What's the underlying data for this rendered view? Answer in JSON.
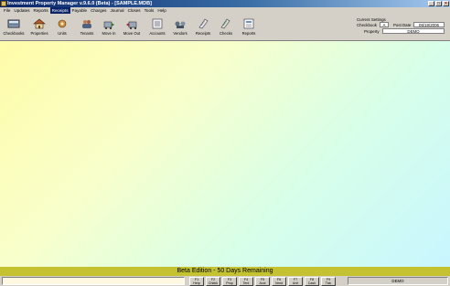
{
  "window": {
    "title": "Investment Property Manager v.9.6.0 (Beta) - [SAMPLE.MDB]"
  },
  "menu": [
    {
      "label": "File"
    },
    {
      "label": "Updates"
    },
    {
      "label": "Reports"
    },
    {
      "label": "Receipts"
    },
    {
      "label": "Payable"
    },
    {
      "label": "Charges"
    },
    {
      "label": "Journal"
    },
    {
      "label": "Closes"
    },
    {
      "label": "Tools"
    },
    {
      "label": "Help"
    }
  ],
  "toolbar": [
    {
      "label": "Checkbooks",
      "icon": "checkbook-icon"
    },
    {
      "label": "Properties",
      "icon": "house-icon"
    },
    {
      "label": "Units",
      "icon": "unit-icon"
    },
    {
      "label": "Tenants",
      "icon": "tenants-icon"
    },
    {
      "label": "Move In",
      "icon": "move-in-icon"
    },
    {
      "label": "Move Out",
      "icon": "move-out-icon"
    },
    {
      "label": "Accounts",
      "icon": "accounts-icon"
    },
    {
      "label": "Vendors",
      "icon": "vendors-icon"
    },
    {
      "label": "Receipts",
      "icon": "receipts-icon"
    },
    {
      "label": "Checks",
      "icon": "checks-icon"
    },
    {
      "label": "Reports",
      "icon": "reports-icon"
    }
  ],
  "settings": {
    "title": "Current Settings",
    "checkbook_label": "Checkbook",
    "checkbook_value": "A",
    "post_date_label": "Post Date",
    "post_date_value": "06/19/2006",
    "property_label": "Property",
    "property_value": "DEMO"
  },
  "beta_banner": "Beta Edition - 50 Days Remaining",
  "fkeys": [
    {
      "key": "F1",
      "label": "Help"
    },
    {
      "key": "F2",
      "label": "Chkbk"
    },
    {
      "key": "F3",
      "label": "Prop"
    },
    {
      "key": "F4",
      "label": "Tent"
    },
    {
      "key": "F5",
      "label": "Acct"
    },
    {
      "key": "F6",
      "label": "Vend"
    },
    {
      "key": "F7",
      "label": "Unit"
    },
    {
      "key": "F8",
      "label": "Cash"
    },
    {
      "key": "F9",
      "label": "Tick"
    }
  ],
  "status": {
    "property": "DEMO"
  },
  "colors": {
    "title_bar": "#0a246a",
    "beta_bar": "#c5c232",
    "workspace_start": "#fffca8",
    "workspace_end": "#c8f6ff"
  }
}
